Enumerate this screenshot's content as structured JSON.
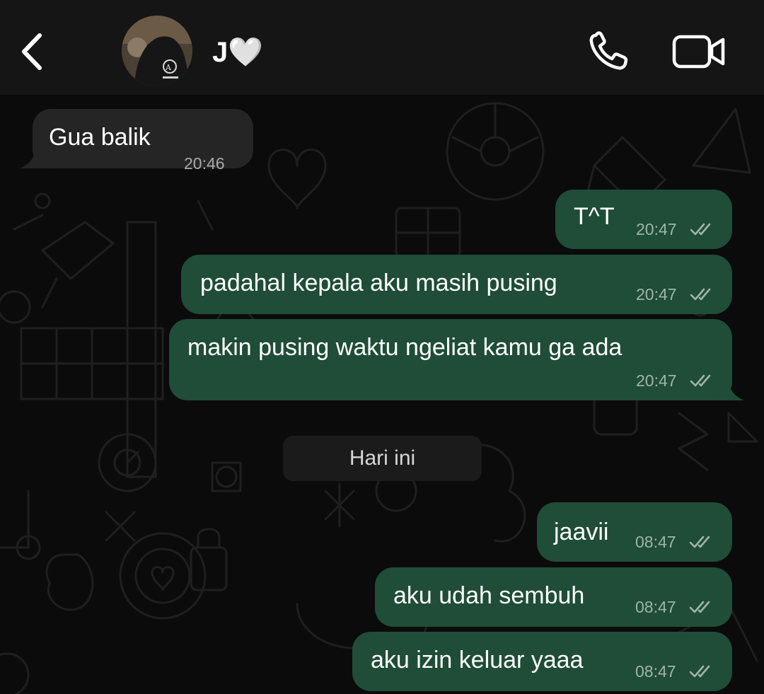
{
  "header": {
    "contact_name": "J🤍",
    "back_icon": "chevron-left-icon",
    "call_icon": "phone-icon",
    "video_icon": "video-camera-icon"
  },
  "messages_before": [
    {
      "direction": "incoming",
      "text": "Gua balik",
      "time": "20:46"
    },
    {
      "direction": "outgoing",
      "text": "T^T",
      "time": "20:47",
      "status": "read"
    },
    {
      "direction": "outgoing",
      "text": "padahal kepala aku masih pusing",
      "time": "20:47",
      "status": "read"
    },
    {
      "direction": "outgoing",
      "text": "makin pusing waktu ngeliat kamu ga ada",
      "time": "20:47",
      "status": "read"
    }
  ],
  "date_separator": "Hari ini",
  "messages_after": [
    {
      "direction": "outgoing",
      "text": "jaavii",
      "time": "08:47",
      "status": "read"
    },
    {
      "direction": "outgoing",
      "text": "aku udah sembuh",
      "time": "08:47",
      "status": "read"
    },
    {
      "direction": "outgoing",
      "text": "aku izin keluar yaaa",
      "time": "08:47",
      "status": "read"
    }
  ],
  "colors": {
    "header_bg": "#151515",
    "chat_bg": "#0b0b0b",
    "incoming_bubble": "#252525",
    "outgoing_bubble": "#1f4d37",
    "tick_color": "#9fb5a8"
  }
}
